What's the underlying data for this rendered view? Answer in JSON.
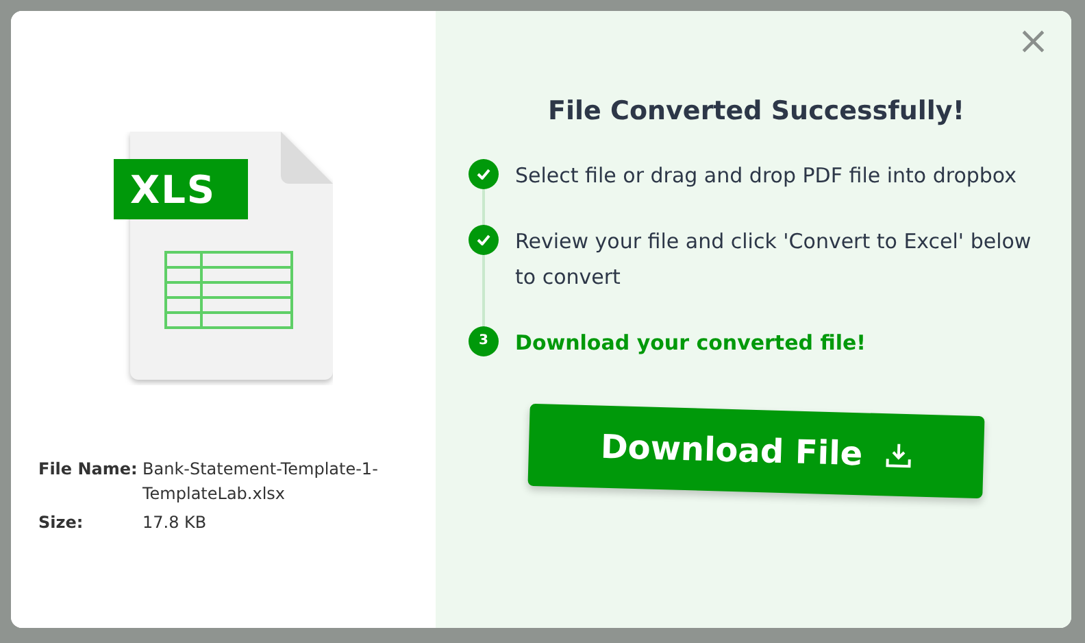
{
  "file_icon": {
    "label": "XLS"
  },
  "title": "File Converted Successfully!",
  "steps": [
    {
      "text": "Select file or drag and drop PDF file into dropbox",
      "completed": true
    },
    {
      "text": "Review your file and click 'Convert to Excel' below to convert",
      "completed": true
    },
    {
      "text": "Download your converted file!",
      "completed": false,
      "number": "3"
    }
  ],
  "file_info": [
    {
      "label": "File Name:",
      "value": "Bank-Statement-Template-1-TemplateLab.xlsx"
    },
    {
      "label": "Size:",
      "value": "17.8 KB"
    }
  ],
  "download_button": {
    "label": "Download File"
  },
  "close": "×"
}
